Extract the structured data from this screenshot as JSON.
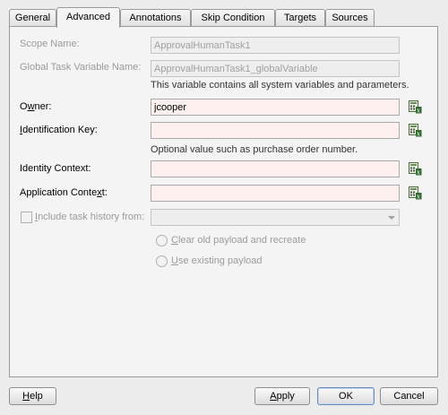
{
  "tabs": [
    {
      "label": "General"
    },
    {
      "label": "Advanced"
    },
    {
      "label": "Annotations"
    },
    {
      "label": "Skip Condition"
    },
    {
      "label": "Targets"
    },
    {
      "label": "Sources"
    }
  ],
  "active_tab": "Advanced",
  "form": {
    "scope_name": {
      "label": "Scope Name:",
      "value": "ApprovalHumanTask1"
    },
    "global_var": {
      "label": "Global Task Variable Name:",
      "value": "ApprovalHumanTask1_globalVariable",
      "hint": "This variable contains all system variables and parameters."
    },
    "owner": {
      "label_pre": "O",
      "label_u": "w",
      "label_post": "ner:",
      "value": "jcooper"
    },
    "ident_key": {
      "label_pre": "",
      "label_u": "I",
      "label_post": "dentification Key:",
      "value": "",
      "hint": "Optional value such as purchase order number."
    },
    "ident_ctx": {
      "label": "Identity Context:",
      "value": ""
    },
    "app_ctx": {
      "label_pre": "Application Conte",
      "label_u": "x",
      "label_post": "t:",
      "value": ""
    },
    "history": {
      "label_pre": "",
      "label_u": "I",
      "label_post": "nclude task history from:",
      "value": ""
    },
    "radio1": {
      "label_pre": "",
      "label_u": "C",
      "label_post": "lear old payload and recreate"
    },
    "radio2": {
      "label_pre": "",
      "label_u": "U",
      "label_post": "se existing payload"
    }
  },
  "buttons": {
    "help": {
      "pre": "",
      "u": "H",
      "post": "elp"
    },
    "apply": {
      "pre": "",
      "u": "A",
      "post": "pply"
    },
    "ok": "OK",
    "cancel": "Cancel"
  },
  "icons": {
    "expression_builder": "expression-builder-icon"
  }
}
